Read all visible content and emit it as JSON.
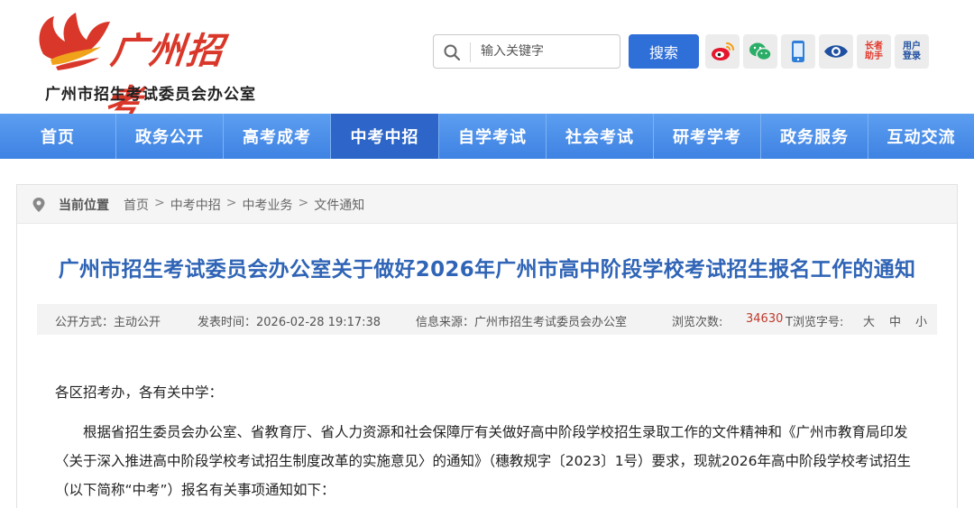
{
  "header": {
    "logo_text": "广州招考",
    "org_name": "广州市招生考试委员会办公室",
    "search_placeholder": "输入关键字",
    "search_button": "搜索",
    "elder_label_1": "长者",
    "elder_label_2": "助手",
    "login_label_1": "用户",
    "login_label_2": "登录",
    "icons": [
      "weibo-icon",
      "wechat-icon",
      "mobile-icon",
      "eye-icon",
      "elder-assist-icon",
      "user-login-icon"
    ]
  },
  "nav": {
    "items": [
      {
        "label": "首页"
      },
      {
        "label": "政务公开"
      },
      {
        "label": "高考成考"
      },
      {
        "label": "中考中招"
      },
      {
        "label": "自学考试"
      },
      {
        "label": "社会考试"
      },
      {
        "label": "研考学考"
      },
      {
        "label": "政务服务"
      },
      {
        "label": "互动交流"
      }
    ],
    "active_index": 3
  },
  "breadcrumb": {
    "label": "当前位置",
    "items": [
      "首页",
      "中考中招",
      "中考业务",
      "文件通知"
    ],
    "separator": ">"
  },
  "article": {
    "title": "广州市招生考试委员会办公室关于做好2026年广州市高中阶段学校考试招生报名工作的通知",
    "meta": {
      "open_type": "公开方式：主动公开",
      "publish_time": "发表时间：2026-02-28 19:17:38",
      "source": "信息来源：广州市招生考试委员会办公室",
      "views_label": "浏览次数:",
      "views": "34630",
      "font_label": "T浏览字号:",
      "font_sizes": [
        "大",
        "中",
        "小"
      ]
    },
    "salutation": "各区招考办，各有关中学：",
    "paragraph": "根据省招生委员会办公室、省教育厅、省人力资源和社会保障厅有关做好高中阶段学校招生录取工作的文件精神和《广州市教育局印发〈关于深入推进高中阶段学校考试招生制度改革的实施意见〉的通知》（穗教规字〔2023〕1号）要求，现就2026年高中阶段学校考试招生（以下简称“中考”）报名有关事项通知如下："
  },
  "colors": {
    "nav_blue": "#4a8de8",
    "nav_active": "#2d66c8",
    "title_blue": "#2f64b6",
    "brand_red": "#d9372a",
    "views_red": "#c0392b",
    "search_button": "#2f6fd8"
  }
}
